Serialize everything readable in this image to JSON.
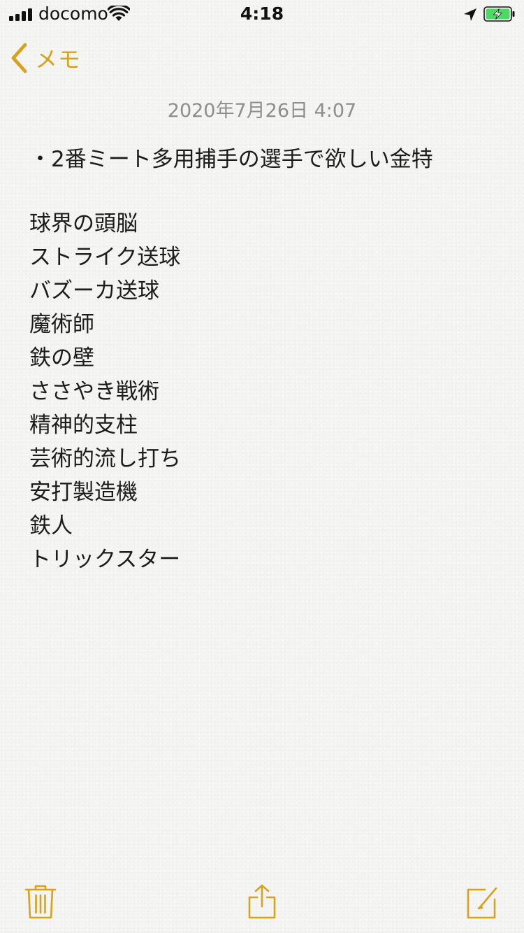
{
  "status_bar": {
    "carrier": "docomo",
    "time": "4:18",
    "signal_bars": 4,
    "battery_charging": true
  },
  "nav": {
    "back_label": "メモ"
  },
  "note": {
    "date": "2020年7月26日 4:07",
    "title": "・2番ミート多用捕手の選手で欲しい金特",
    "lines": [
      "球界の頭脳",
      "ストライク送球",
      "バズーカ送球",
      "魔術師",
      "鉄の壁",
      "ささやき戦術",
      "精神的支柱",
      "芸術的流し打ち",
      "安打製造機",
      "鉄人",
      "トリックスター"
    ]
  },
  "toolbar": {
    "icons": [
      "trash-icon",
      "share-icon",
      "compose-icon"
    ]
  },
  "colors": {
    "accent": "#d7a21e",
    "background": "#f4f4f2",
    "date_text": "#8e8e8e",
    "body_text": "#1c1c1c",
    "battery_fill": "#4cd964"
  }
}
